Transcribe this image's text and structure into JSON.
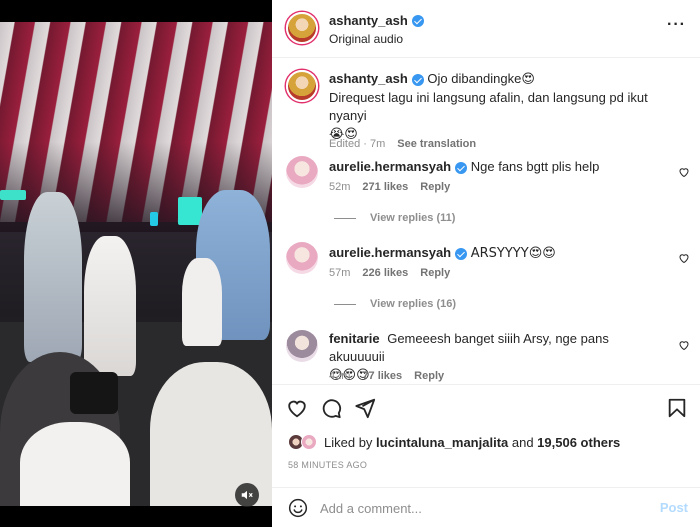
{
  "post": {
    "username": "ashanty_ash",
    "audio": "Original audio",
    "more_icon": "more-horizontal-icon"
  },
  "caption": {
    "username": "ashanty_ash",
    "line1": "Ojo dibandingke",
    "line1_emoji": "😍",
    "line2": "Direquest lagu ini langsung afalin, dan langsung pd ikut nyanyi",
    "line3_emoji": "😭😍",
    "edited": "Edited · 7m",
    "see_translation": "See translation"
  },
  "comments": [
    {
      "username": "aurelie.hermansyah",
      "text": "Nge fans bgtt plis help",
      "time": "52m",
      "likes": "271 likes",
      "reply": "Reply",
      "view_replies": "View replies (11)"
    },
    {
      "username": "aurelie.hermansyah",
      "text": "ARSYYYY😍😍",
      "time": "57m",
      "likes": "226 likes",
      "reply": "Reply",
      "view_replies": "View replies (16)"
    },
    {
      "username": "fenitarie",
      "text": "Gemeeesh banget siiih Arsy, nge pans akuuuuuii",
      "text_emoji": "😍😍😍",
      "time": "42m",
      "likes": "77 likes",
      "reply": "Reply"
    }
  ],
  "likes_summary": {
    "prefix": "Liked by ",
    "user": "lucintaluna_manjalita",
    "middle": " and ",
    "others": "19,506 others"
  },
  "time_ago": "58 MINUTES AGO",
  "comment_box": {
    "placeholder": "Add a comment...",
    "post_label": "Post"
  },
  "colors": {
    "verified": "#3897f0",
    "post_button": "#b3dbff",
    "secondary_text": "#8e8e8e"
  },
  "icons": [
    "heart-icon",
    "comment-icon",
    "share-icon",
    "bookmark-icon",
    "emoji-icon",
    "mute-icon",
    "verified-icon"
  ]
}
